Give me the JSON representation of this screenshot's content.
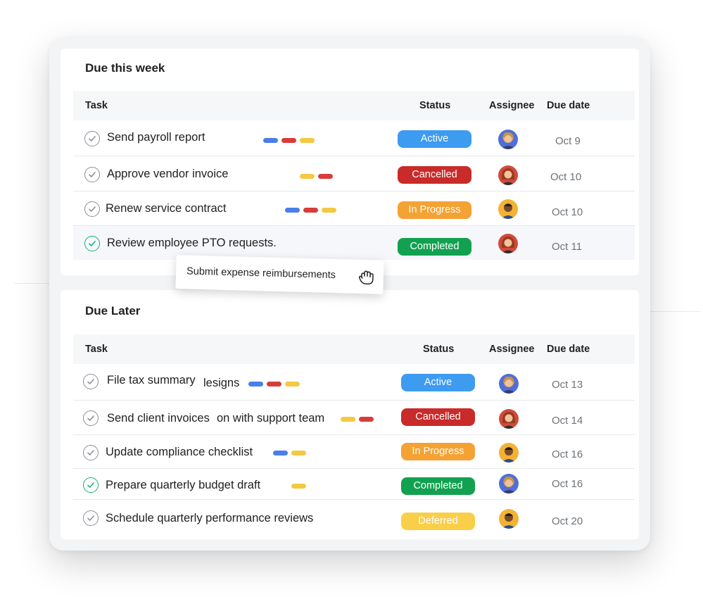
{
  "colors": {
    "active": "#3d9bf0",
    "cancelled": "#c92a2a",
    "in_progress": "#f4a233",
    "completed": "#12a150",
    "deferred": "#f9cf4a",
    "tag_blue": "#4a7ee8",
    "tag_red": "#d93b3b",
    "tag_yellow": "#f5c842"
  },
  "headers": {
    "task": "Task",
    "status": "Status",
    "assignee": "Assignee",
    "due_date": "Due date"
  },
  "due_this_week": {
    "title": "Due this week",
    "rows": [
      {
        "task": "Send payroll report",
        "status": "Active",
        "due": "Oct 9",
        "tags": [
          "blue",
          "red",
          "yellow"
        ],
        "check_icon": "check-circle-icon",
        "avatar": "avatar-woman-blonde"
      },
      {
        "task": "Approve vendor invoice",
        "status": "Cancelled",
        "due": "Oct 10",
        "tags": [
          "yellow",
          "red"
        ],
        "check_icon": "check-circle-icon",
        "avatar": "avatar-woman-redhair"
      },
      {
        "task": "Renew service contract",
        "status": "In Progress",
        "due": "Oct 10",
        "tags": [
          "blue",
          "red",
          "yellow"
        ],
        "check_icon": "check-circle-icon",
        "avatar": "avatar-man-dark"
      },
      {
        "task": "Review employee PTO requests.",
        "status": "Completed",
        "due": "Oct 11",
        "tags": [],
        "check_icon": "check-circle-done-icon",
        "avatar": "avatar-woman-redhair"
      }
    ]
  },
  "drag_card": {
    "label": "Submit expense reimbursements",
    "icon": "grab-hand-icon"
  },
  "due_later": {
    "title": "Due Later",
    "rows": [
      {
        "task": "File tax summary",
        "overlap_text": "lesigns",
        "status": "Active",
        "due": "Oct 13",
        "tags": [
          "blue",
          "red",
          "yellow"
        ],
        "check_icon": "check-circle-icon",
        "avatar": "avatar-woman-blonde"
      },
      {
        "task": "Send client invoices",
        "overlap_text": "on with support team",
        "status": "Cancelled",
        "due": "Oct 14",
        "tags": [
          "yellow",
          "red"
        ],
        "check_icon": "check-circle-icon",
        "avatar": "avatar-woman-redhair"
      },
      {
        "task": "Update compliance checklist",
        "status": "In Progress",
        "due": "Oct 16",
        "tags": [
          "blue",
          "yellow"
        ],
        "check_icon": "check-circle-icon",
        "avatar": "avatar-man-dark"
      },
      {
        "task": "Prepare quarterly budget draft",
        "status": "Completed",
        "due": "Oct 16",
        "tags": [
          "yellow"
        ],
        "check_icon": "check-circle-done-icon",
        "avatar": "avatar-woman-blonde"
      },
      {
        "task": "Schedule quarterly performance reviews",
        "status": "Deferred",
        "due": "Oct 20",
        "tags": [],
        "check_icon": "check-circle-icon",
        "avatar": "avatar-man-dark"
      }
    ]
  }
}
